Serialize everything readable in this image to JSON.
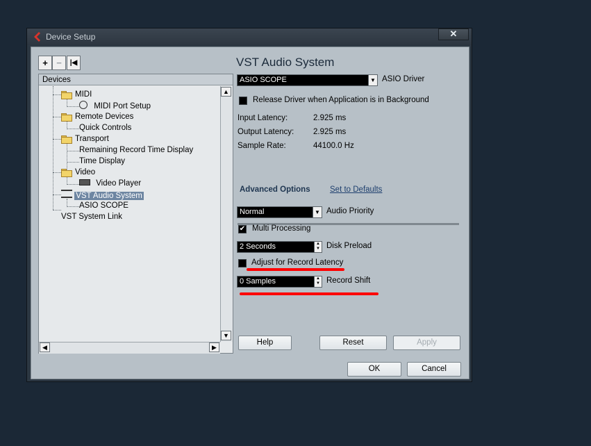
{
  "window": {
    "title": "Device Setup",
    "close_label": "✕"
  },
  "toolbar": {
    "add": "+",
    "remove": "−",
    "reset": "|◀"
  },
  "devices": {
    "header": "Devices",
    "tree": [
      {
        "label": "MIDI"
      },
      {
        "label": "MIDI Port Setup"
      },
      {
        "label": "Remote Devices"
      },
      {
        "label": "Quick Controls"
      },
      {
        "label": "Transport"
      },
      {
        "label": "Remaining Record Time Display"
      },
      {
        "label": "Time Display"
      },
      {
        "label": "Video"
      },
      {
        "label": "Video Player"
      },
      {
        "label": "VST Audio System"
      },
      {
        "label": "ASIO SCOPE"
      },
      {
        "label": "VST System Link"
      }
    ]
  },
  "vst": {
    "title": "VST Audio System",
    "driver": {
      "value": "ASIO SCOPE",
      "label": "ASIO Driver"
    },
    "release_driver": {
      "label": "Release Driver when Application is in Background",
      "checked": false
    },
    "info": [
      {
        "label": "Input Latency:",
        "value": "2.925 ms"
      },
      {
        "label": "Output Latency:",
        "value": "2.925 ms"
      },
      {
        "label": "Sample Rate:",
        "value": "44100.0 Hz"
      }
    ],
    "advanced": {
      "title": "Advanced Options",
      "defaults_link": "Set to Defaults",
      "audio_priority": {
        "value": "Normal",
        "label": "Audio Priority"
      },
      "multi_processing": {
        "label": "Multi Processing",
        "checked": true
      },
      "disk_preload": {
        "value": "2 Seconds",
        "label": "Disk Preload"
      },
      "adjust_latency": {
        "label": "Adjust for Record Latency",
        "checked": false
      },
      "record_shift": {
        "value": "0 Samples",
        "label": "Record Shift"
      }
    },
    "buttons": {
      "help": "Help",
      "reset": "Reset",
      "apply": "Apply"
    }
  },
  "footer": {
    "ok": "OK",
    "cancel": "Cancel"
  },
  "colors": {
    "background": "#1b2836",
    "annotation": "#ff0000",
    "selection": "#6e86a2"
  }
}
